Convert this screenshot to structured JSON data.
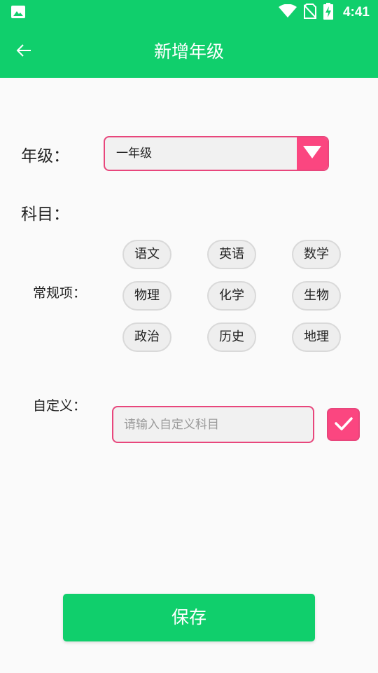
{
  "status_bar": {
    "time": "4:41",
    "icons": [
      "image-icon",
      "wifi-icon",
      "no-sim-icon",
      "battery-charging-icon"
    ]
  },
  "app_bar": {
    "title": "新增年级",
    "back_icon": "arrow-left-icon"
  },
  "form": {
    "grade_label": "年级：",
    "grade_selected": "一年级",
    "grade_dropdown_icon": "triangle-down-icon",
    "subject_label": "科目：",
    "regular_label": "常规项：",
    "regular_subjects": [
      "语文",
      "英语",
      "数学",
      "物理",
      "化学",
      "生物",
      "政治",
      "历史",
      "地理"
    ],
    "custom_label": "自定义：",
    "custom_value": "",
    "custom_placeholder": "请输入自定义科目",
    "confirm_icon": "checkmark-icon"
  },
  "actions": {
    "save_label": "保存"
  },
  "colors": {
    "primary": "#10cf6c",
    "accent": "#fb4680",
    "accent_border": "#e8467c"
  }
}
